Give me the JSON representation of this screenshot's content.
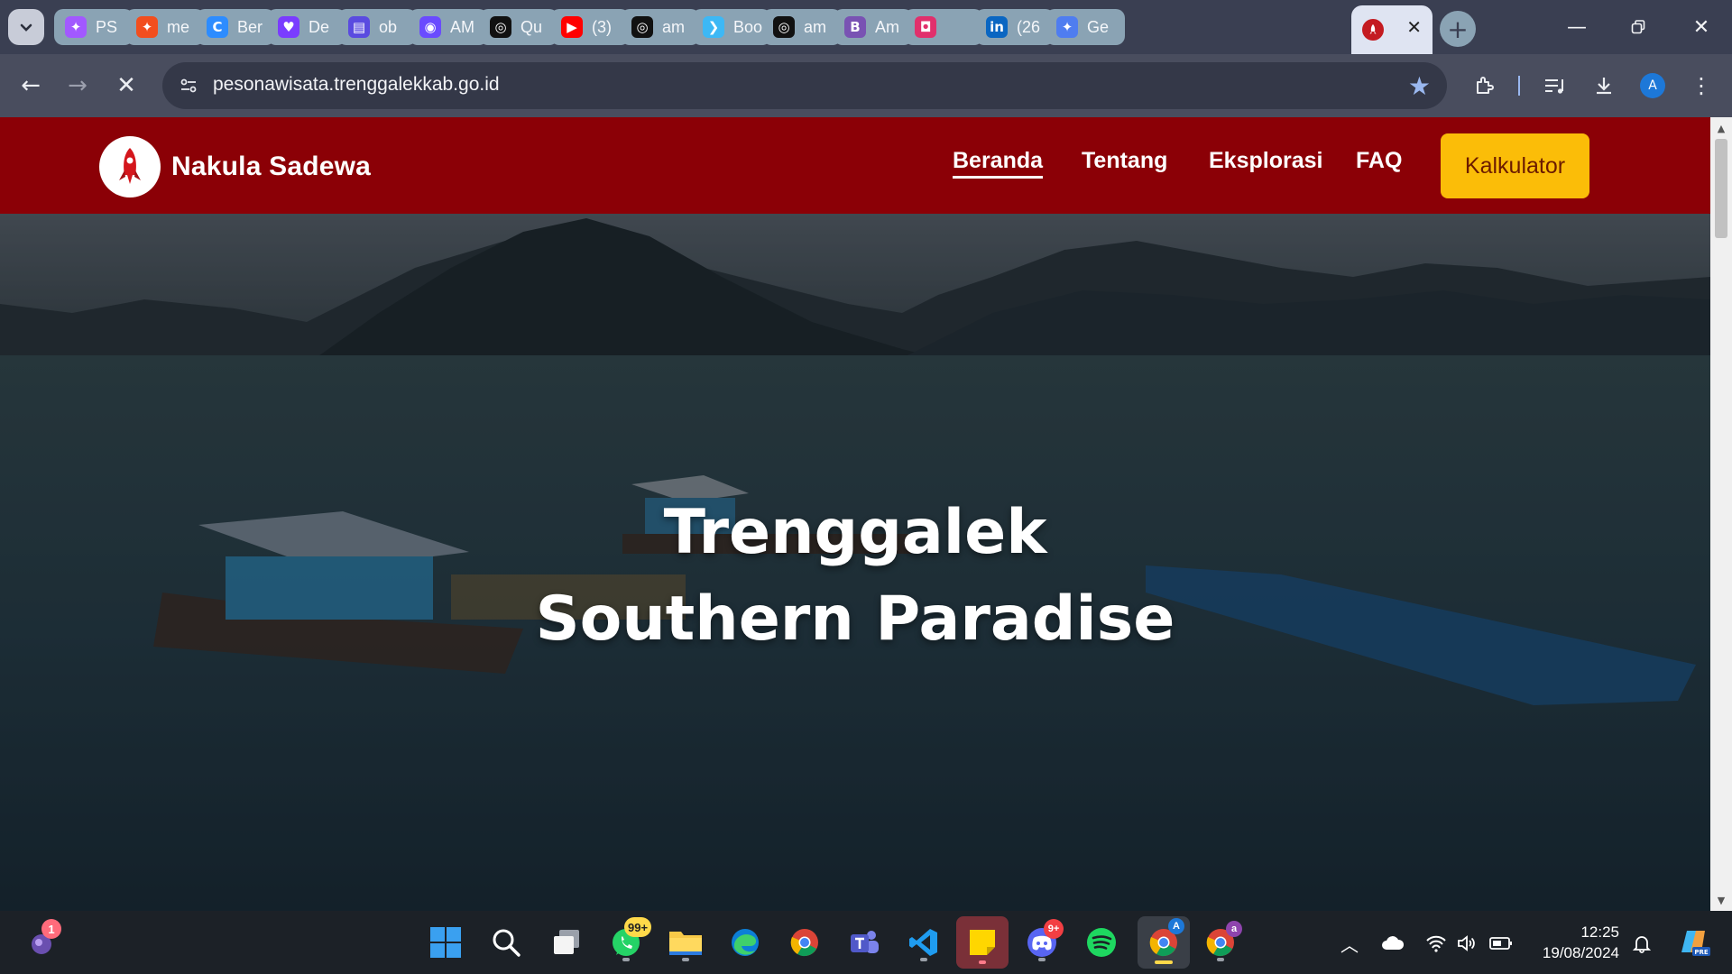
{
  "browser": {
    "tabs": [
      {
        "title": "PS",
        "icon": "figma-icon",
        "color": "#a259ff"
      },
      {
        "title": "me",
        "icon": "figma-icon",
        "color": "#f24e1e"
      },
      {
        "title": "Ber",
        "icon": "canva-icon",
        "color": "#2d8cff"
      },
      {
        "title": "De",
        "icon": "heart-icon",
        "color": "#7a3cff"
      },
      {
        "title": "ob",
        "icon": "printer-icon",
        "color": "#5a4be0"
      },
      {
        "title": "AM",
        "icon": "meta-icon",
        "color": "#6a4bff"
      },
      {
        "title": "Qu",
        "icon": "github-icon",
        "color": "#111111"
      },
      {
        "title": "(3)",
        "icon": "youtube-icon",
        "color": "#ff0000"
      },
      {
        "title": "am",
        "icon": "github-icon",
        "color": "#111111"
      },
      {
        "title": "Boo",
        "icon": "flutter-icon",
        "color": "#3db8f5"
      },
      {
        "title": "am",
        "icon": "github-icon",
        "color": "#111111"
      },
      {
        "title": "Am",
        "icon": "bootstrap-icon",
        "color": "#7952b3"
      },
      {
        "title": "",
        "icon": "instagram-icon",
        "color": "#e1306c"
      },
      {
        "title": "(26",
        "icon": "linkedin-icon",
        "color": "#0a66c2"
      },
      {
        "title": "Ge",
        "icon": "gemini-icon",
        "color": "#4f7df0"
      }
    ],
    "active_tab_icon": "rocket-icon",
    "url": "pesonawisata.trenggalekkab.go.id",
    "profile_initial": "A"
  },
  "site": {
    "brand": "Nakula Sadewa",
    "nav": {
      "home": "Beranda",
      "about": "Tentang",
      "explore": "Eksplorasi",
      "faq": "FAQ",
      "calculator": "Kalkulator"
    },
    "hero": {
      "line1": "Trenggalek",
      "line2": "Southern Paradise"
    },
    "colors": {
      "nav_bg": "#8b0006",
      "button_bg": "#fbbd08"
    }
  },
  "taskbar": {
    "notification_count": "1",
    "whatsapp_badge": "99+",
    "discord_badge": "9+",
    "chrome_profile_initial": "A",
    "chrome2_profile_initial": "a",
    "time": "12:25",
    "date": "19/08/2024"
  }
}
